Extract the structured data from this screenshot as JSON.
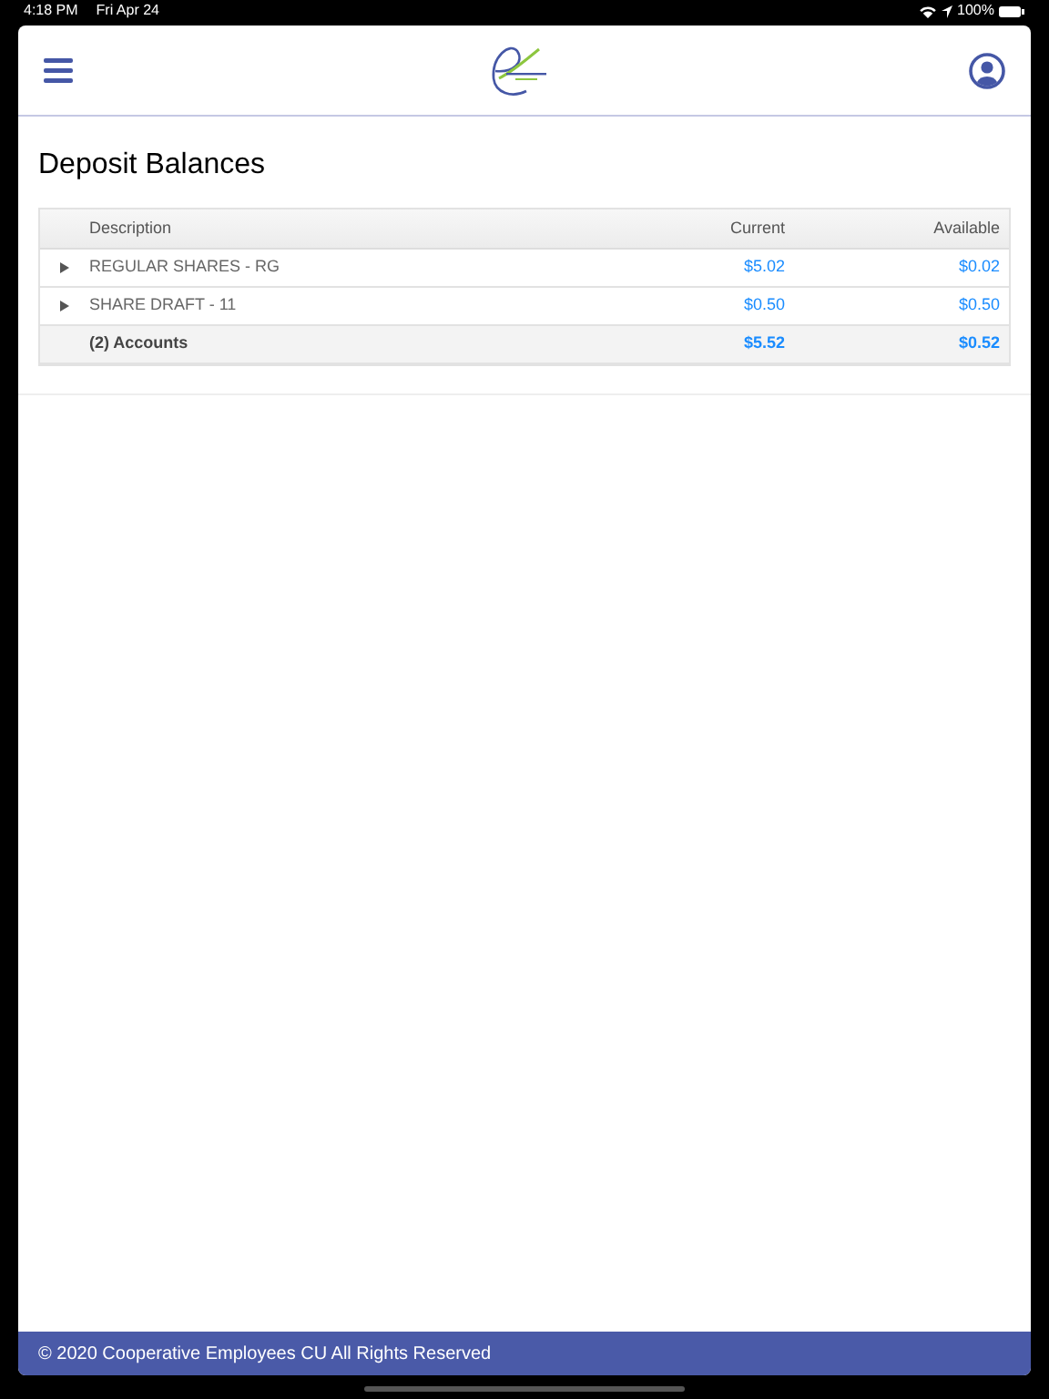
{
  "status_bar": {
    "time": "4:18 PM",
    "date": "Fri Apr 24",
    "battery": "100%"
  },
  "page_title": "Deposit Balances",
  "table": {
    "columns": [
      "Description",
      "Current",
      "Available"
    ],
    "rows": [
      {
        "kind": "account",
        "description": "REGULAR SHARES - RG",
        "current": "$5.02",
        "available": "$0.02"
      },
      {
        "kind": "account",
        "description": "SHARE DRAFT - 11",
        "current": "$0.50",
        "available": "$0.50"
      },
      {
        "kind": "total",
        "description": "(2) Accounts",
        "current": "$5.52",
        "available": "$0.52"
      }
    ]
  },
  "footer": "© 2020 Cooperative Employees CU All Rights Reserved"
}
